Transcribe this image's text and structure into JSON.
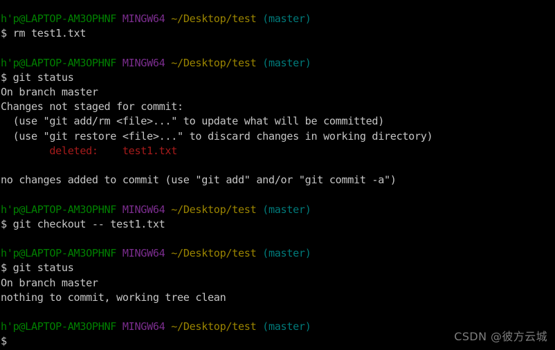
{
  "terminal": {
    "title": "MINGW64 ~/Desktop/test",
    "colors": {
      "background": "#000000",
      "user_host": "#008000",
      "shell_name": "#7b2d8e",
      "path": "#9a8400",
      "branch": "#007a7a",
      "output": "#c6c6c6",
      "deleted": "#a61b1b",
      "watermark": "#7e7e7e"
    },
    "prompt": {
      "user_host": "h'p@LAPTOP-AM3OPHNF",
      "shell_name": "MINGW64",
      "path": "~/Desktop/test",
      "branch": "(master)",
      "sigil": "$"
    },
    "lines": [
      {
        "type": "prompt"
      },
      {
        "type": "command",
        "text": "$ rm test1.txt"
      },
      {
        "type": "blank"
      },
      {
        "type": "prompt"
      },
      {
        "type": "command",
        "text": "$ git status"
      },
      {
        "type": "output",
        "text": "On branch master"
      },
      {
        "type": "output",
        "text": "Changes not staged for commit:"
      },
      {
        "type": "output",
        "text": "  (use \"git add/rm <file>...\" to update what will be committed)"
      },
      {
        "type": "output",
        "text": "  (use \"git restore <file>...\" to discard changes in working directory)"
      },
      {
        "type": "deleted",
        "text": "        deleted:    test1.txt"
      },
      {
        "type": "blank"
      },
      {
        "type": "output",
        "text": "no changes added to commit (use \"git add\" and/or \"git commit -a\")"
      },
      {
        "type": "blank"
      },
      {
        "type": "prompt"
      },
      {
        "type": "command",
        "text": "$ git checkout -- test1.txt"
      },
      {
        "type": "blank"
      },
      {
        "type": "prompt"
      },
      {
        "type": "command",
        "text": "$ git status"
      },
      {
        "type": "output",
        "text": "On branch master"
      },
      {
        "type": "output",
        "text": "nothing to commit, working tree clean"
      },
      {
        "type": "blank"
      },
      {
        "type": "prompt"
      },
      {
        "type": "command",
        "text": "$"
      }
    ]
  },
  "watermark": {
    "text": "CSDN @彼方云城"
  }
}
